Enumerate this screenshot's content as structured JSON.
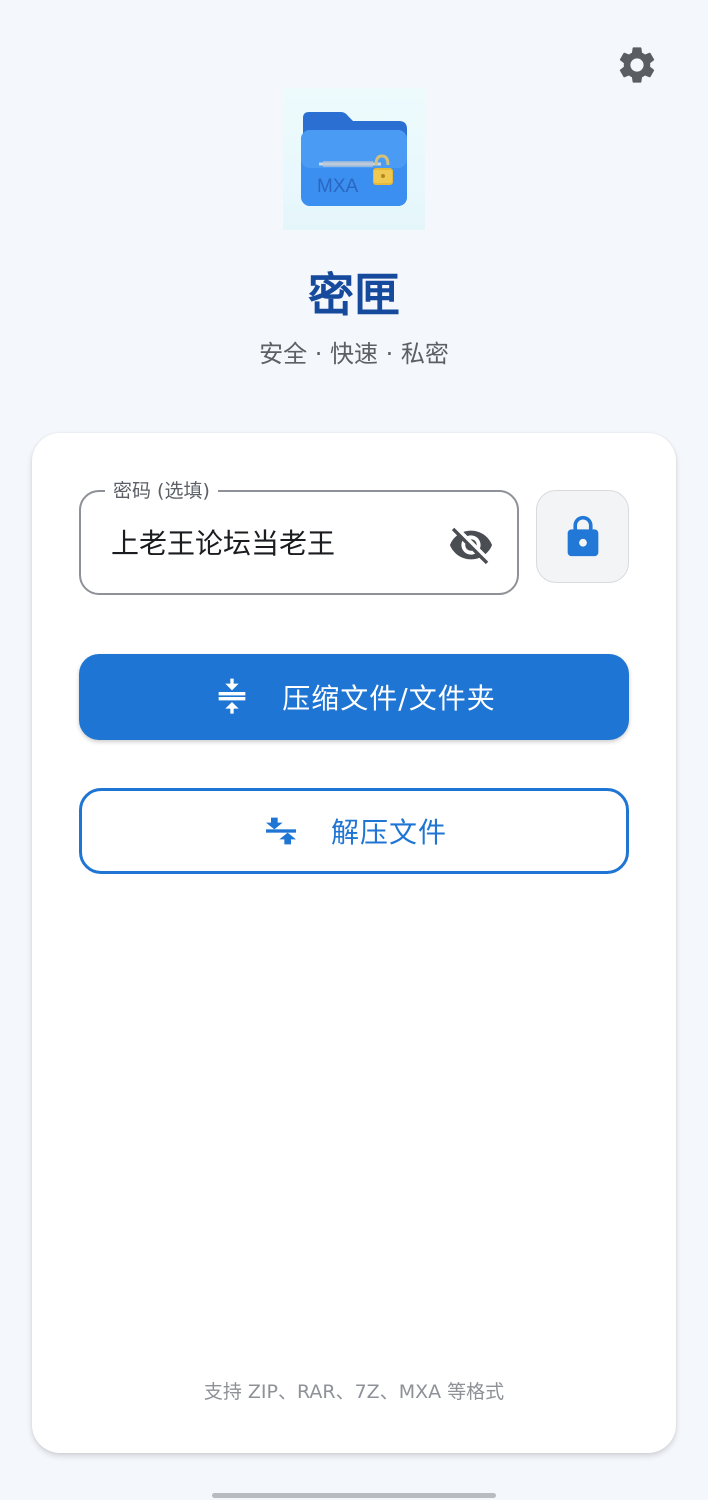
{
  "header": {
    "settings_icon": "gear-icon"
  },
  "app": {
    "icon_text": "MXA",
    "title": "密匣",
    "subtitle": "安全 · 快速 · 私密"
  },
  "password": {
    "label": "密码 (选填)",
    "value": "上老王论坛当老王",
    "visibility_icon": "eye-off-icon",
    "lock_icon": "lock-icon"
  },
  "actions": {
    "compress_label": "压缩文件/文件夹",
    "compress_icon": "compress-icon",
    "extract_label": "解压文件",
    "extract_icon": "expand-icon"
  },
  "footer": {
    "note": "支持 ZIP、RAR、7Z、MXA 等格式"
  },
  "colors": {
    "primary": "#1f75d3",
    "title": "#154a9c",
    "background": "#f4f7fb",
    "lock_accent": "#2178d6"
  }
}
